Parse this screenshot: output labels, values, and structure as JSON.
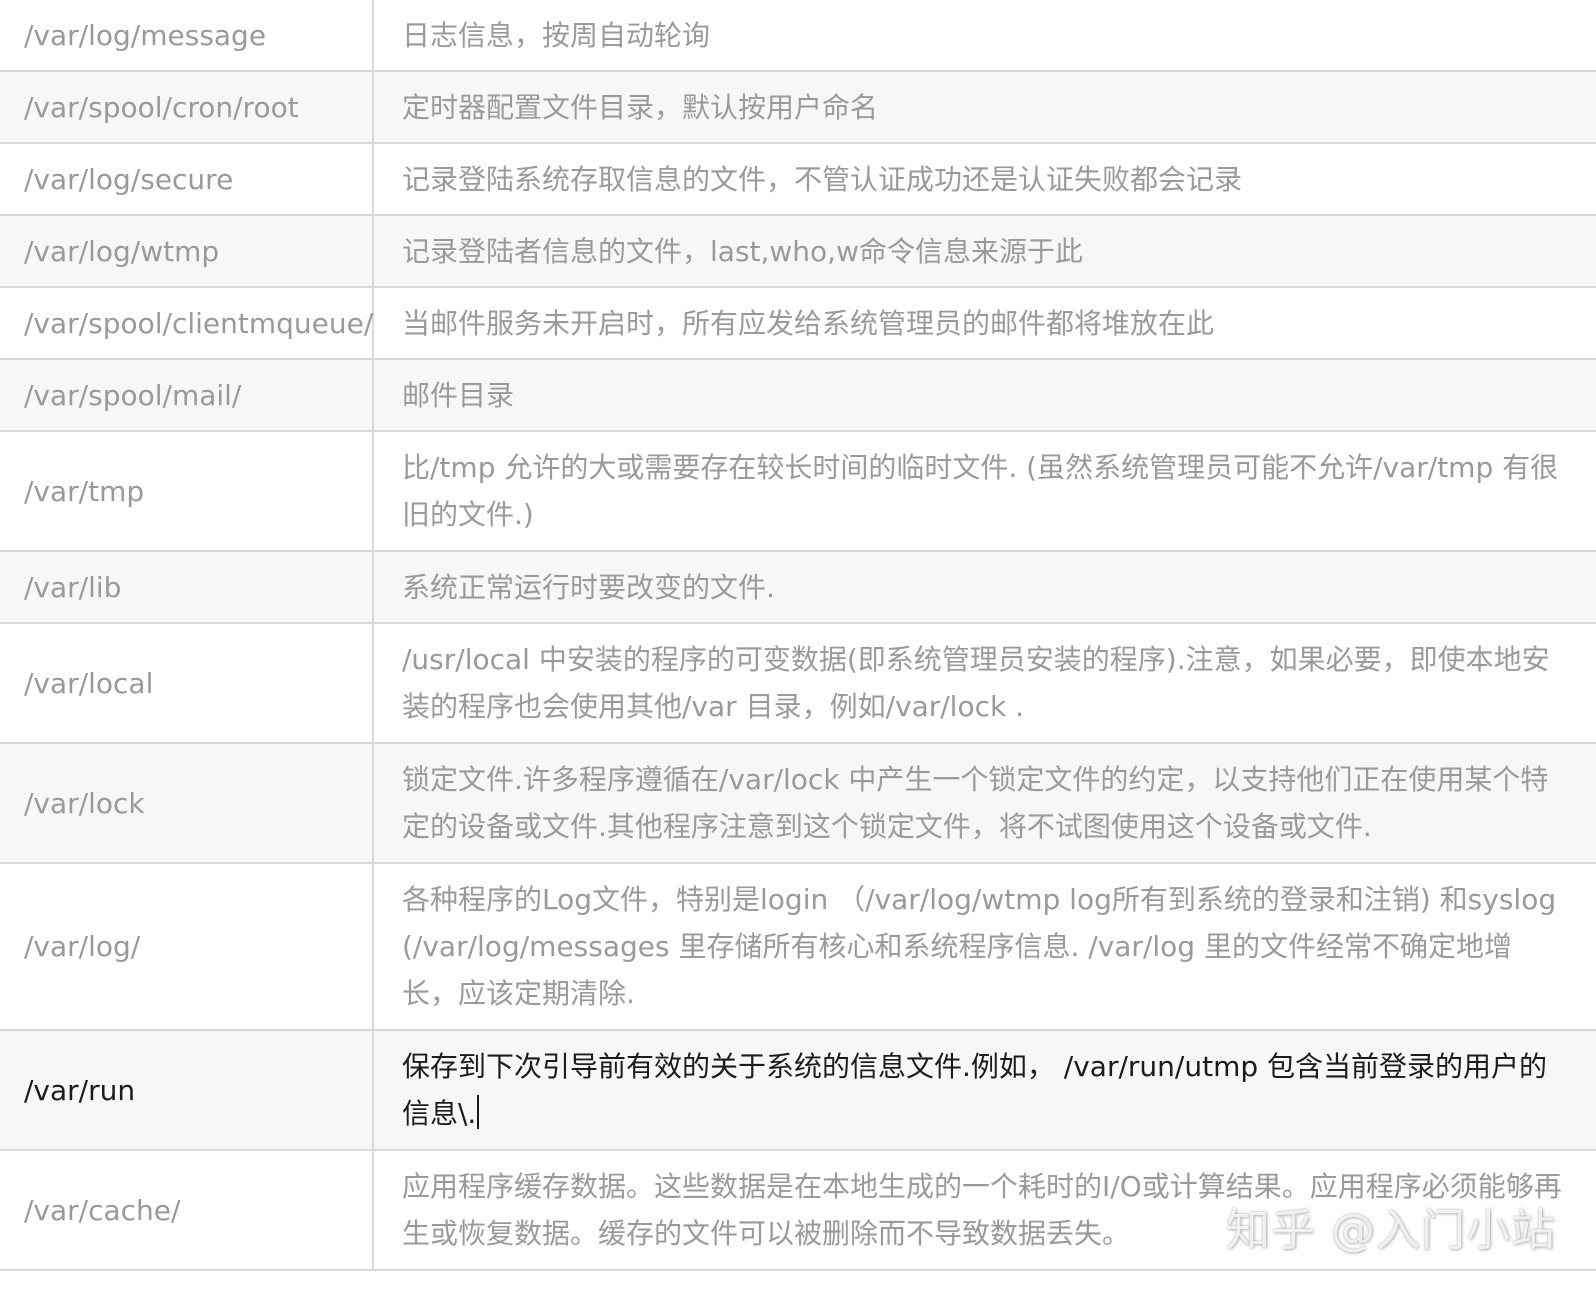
{
  "rows": [
    {
      "path": "/var/log/message",
      "desc": "日志信息，按周自动轮询"
    },
    {
      "path": "/var/spool/cron/root",
      "desc": "定时器配置文件目录，默认按用户命名"
    },
    {
      "path": "/var/log/secure",
      "desc": "记录登陆系统存取信息的文件，不管认证成功还是认证失败都会记录"
    },
    {
      "path": "/var/log/wtmp",
      "desc": "记录登陆者信息的文件，last,who,w命令信息来源于此"
    },
    {
      "path": "/var/spool/clientmqueue/",
      "desc": "当邮件服务未开启时，所有应发给系统管理员的邮件都将堆放在此"
    },
    {
      "path": "/var/spool/mail/",
      "desc": "邮件目录"
    },
    {
      "path": "/var/tmp",
      "desc": "比/tmp 允许的大或需要存在较长时间的临时文件. (虽然系统管理员可能不允许/var/tmp 有很旧的文件.)"
    },
    {
      "path": "/var/lib",
      "desc": "系统正常运行时要改变的文件."
    },
    {
      "path": "/var/local",
      "desc": "/usr/local 中安装的程序的可变数据(即系统管理员安装的程序).注意，如果必要，即使本地安装的程序也会使用其他/var 目录，例如/var/lock ."
    },
    {
      "path": "/var/lock",
      "desc": "锁定文件.许多程序遵循在/var/lock 中产生一个锁定文件的约定，以支持他们正在使用某个特定的设备或文件.其他程序注意到这个锁定文件，将不试图使用这个设备或文件."
    },
    {
      "path": "/var/log/",
      "desc": "各种程序的Log文件，特别是login （/var/log/wtmp log所有到系统的登录和注销) 和syslog (/var/log/messages 里存储所有核心和系统程序信息. /var/log 里的文件经常不确定地增长，应该定期清除."
    },
    {
      "path": "/var/run",
      "desc": "保存到下次引导前有效的关于系统的信息文件.例如， /var/run/utmp 包含当前登录的用户的信息\\."
    },
    {
      "path": "/var/cache/",
      "desc": "应用程序缓存数据。这些数据是在本地生成的一个耗时的I/O或计算结果。应用程序必须能够再生或恢复数据。缓存的文件可以被删除而不导致数据丢失。"
    }
  ],
  "watermark": "知乎 @入门小站"
}
